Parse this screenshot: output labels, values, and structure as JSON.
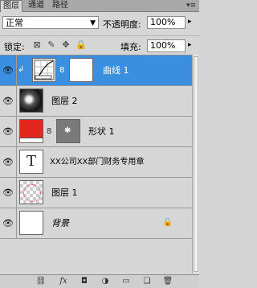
{
  "tabs": [
    {
      "label": "图层"
    },
    {
      "label": "通道"
    },
    {
      "label": "路径"
    }
  ],
  "blend": {
    "mode": "正常",
    "opacity_label": "不透明度:",
    "opacity_value": "100%"
  },
  "lock": {
    "label": "锁定:",
    "fill_label": "填充:",
    "fill_value": "100%"
  },
  "layers": [
    {
      "name": "曲线 1",
      "type": "adjustment"
    },
    {
      "name": "图层 2",
      "type": "pixel"
    },
    {
      "name": "形状 1",
      "type": "shape"
    },
    {
      "name": "XX公司XX部门财务专用章",
      "type": "text"
    },
    {
      "name": "图层 1",
      "type": "pixel"
    },
    {
      "name": "背景",
      "type": "background"
    }
  ],
  "colors": {
    "selected": "#3b8fe0",
    "shape_fill": "#e0261d"
  }
}
